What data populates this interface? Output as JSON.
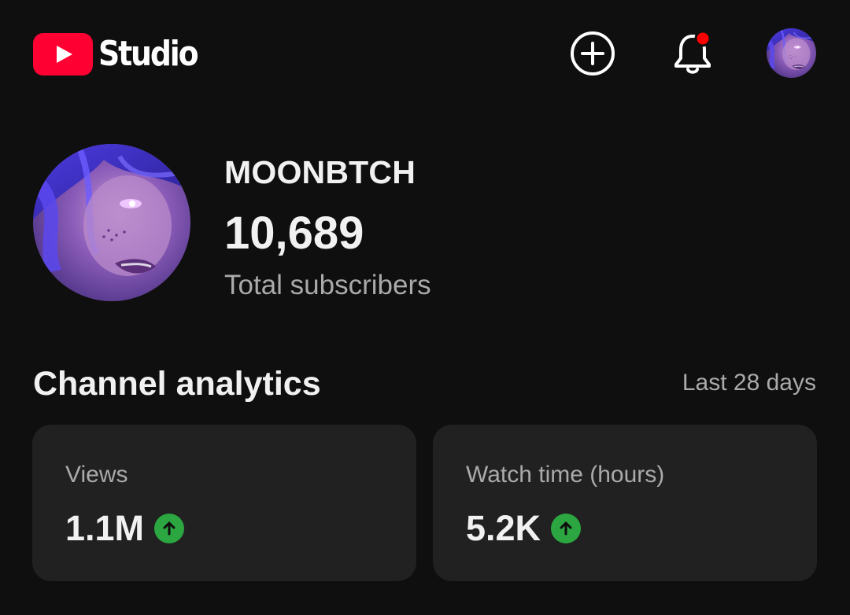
{
  "app": {
    "logo_text": "Studio",
    "brand_color": "#ff0033"
  },
  "header": {
    "create_icon": "add-circle-icon",
    "notifications_icon": "bell-icon",
    "notification_dot_color": "#ff0000",
    "account_icon": "account-avatar"
  },
  "channel": {
    "name": "MOONBTCH",
    "subscriber_count": "10,689",
    "subscriber_label": "Total subscribers"
  },
  "analytics": {
    "title": "Channel analytics",
    "range": "Last 28 days",
    "trend_color": "#2ba640",
    "cards": [
      {
        "label": "Views",
        "value": "1.1M",
        "trend": "up"
      },
      {
        "label": "Watch time (hours)",
        "value": "5.2K",
        "trend": "up"
      }
    ]
  }
}
